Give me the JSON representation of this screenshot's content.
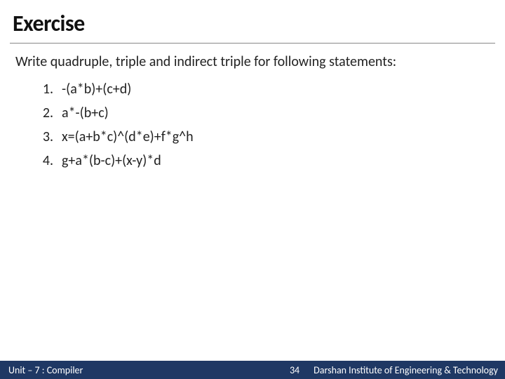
{
  "title": "Exercise",
  "prompt": "Write quadruple, triple and indirect triple for following statements:",
  "items": [
    {
      "num": "1.",
      "expr": "-(a*b)+(c+d)"
    },
    {
      "num": "2.",
      "expr": "a*-(b+c)"
    },
    {
      "num": "3.",
      "expr": "x=(a+b*c)^(d*e)+f*g^h"
    },
    {
      "num": "4.",
      "expr": "g+a*(b-c)+(x-y)*d"
    }
  ],
  "footer": {
    "unit": "Unit – 7 : Compiler",
    "page": "34",
    "org": "Darshan Institute of Engineering & Technology"
  }
}
